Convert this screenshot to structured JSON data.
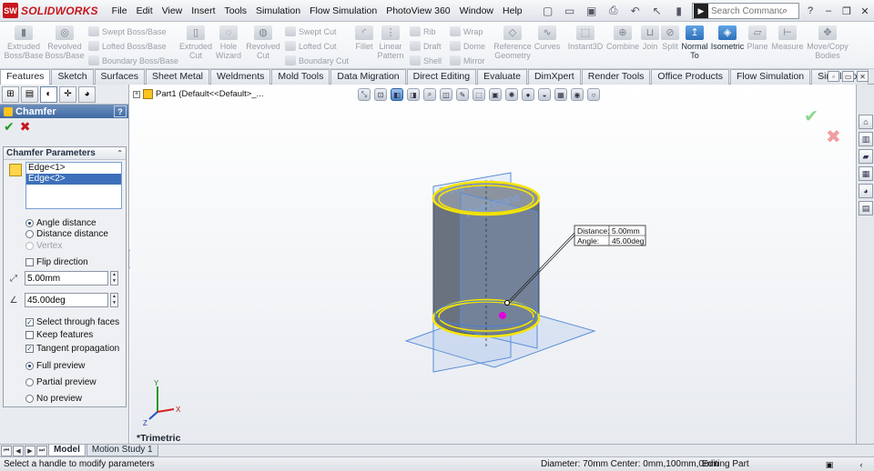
{
  "app": {
    "logo_prefix": "SW",
    "logo_text": "SOLIDWORKS"
  },
  "menu": [
    "File",
    "Edit",
    "View",
    "Insert",
    "Tools",
    "Simulation",
    "Flow Simulation",
    "PhotoView 360",
    "Window",
    "Help"
  ],
  "search": {
    "prefix": "▶",
    "placeholder": "Search Commands"
  },
  "toolbar": {
    "extruded_boss": "Extruded Boss/Base",
    "revolved_boss": "Revolved Boss/Base",
    "swept_boss": "Swept Boss/Base",
    "lofted_boss": "Lofted Boss/Base",
    "boundary_boss": "Boundary Boss/Base",
    "extruded_cut": "Extruded Cut",
    "hole_wizard": "Hole Wizard",
    "revolved_cut": "Revolved Cut",
    "swept_cut": "Swept Cut",
    "lofted_cut": "Lofted Cut",
    "boundary_cut": "Boundary Cut",
    "fillet": "Fillet",
    "linear_pattern": "Linear Pattern",
    "rib": "Rib",
    "draft": "Draft",
    "shell": "Shell",
    "wrap": "Wrap",
    "dome": "Dome",
    "mirror": "Mirror",
    "reference_geometry": "Reference Geometry",
    "curves": "Curves",
    "instant3d": "Instant3D",
    "combine": "Combine",
    "join": "Join",
    "split": "Split",
    "normal_to": "Normal To",
    "isometric": "Isometric",
    "plane": "Plane",
    "measure": "Measure",
    "move_copy": "Move/Copy Bodies"
  },
  "tabs": [
    "Features",
    "Sketch",
    "Surfaces",
    "Sheet Metal",
    "Weldments",
    "Mold Tools",
    "Data Migration",
    "Direct Editing",
    "Evaluate",
    "DimXpert",
    "Render Tools",
    "Office Products",
    "Flow Simulation",
    "Simulation"
  ],
  "property_manager": {
    "title": "Chamfer",
    "help": "?",
    "group_title": "Chamfer Parameters",
    "edges": [
      "Edge<1>",
      "Edge<2>"
    ],
    "angle_distance": "Angle distance",
    "distance_distance": "Distance distance",
    "vertex": "Vertex",
    "flip_direction": "Flip direction",
    "distance_value": "5.00mm",
    "angle_value": "45.00deg",
    "select_through_faces": "Select through faces",
    "keep_features": "Keep features",
    "tangent_propagation": "Tangent propagation",
    "full_preview": "Full preview",
    "partial_preview": "Partial preview",
    "no_preview": "No preview"
  },
  "tree": {
    "part": "Part1  (Default<<Default>_..."
  },
  "callout": {
    "distance_label": "Distance:",
    "distance_value": "5.00mm",
    "angle_label": "Angle:",
    "angle_value": "45.00deg"
  },
  "viewport": {
    "front_plane": "Front Plane",
    "right_plane": "Right Plane",
    "view_name": "*Trimetric",
    "axis_x": "X",
    "axis_y": "Y",
    "axis_z": "Z"
  },
  "bottom_tabs": [
    "Model",
    "Motion Study 1"
  ],
  "status": {
    "message": "Select a handle to modify parameters",
    "measure": "Diameter: 70mm  Center: 0mm,100mm,0mm",
    "mode": "Editing Part"
  },
  "colors": {
    "brand": "#c8161d",
    "highlight": "#f5e400",
    "plane_blue": "#5b8fd6",
    "body": "#6a7280"
  }
}
